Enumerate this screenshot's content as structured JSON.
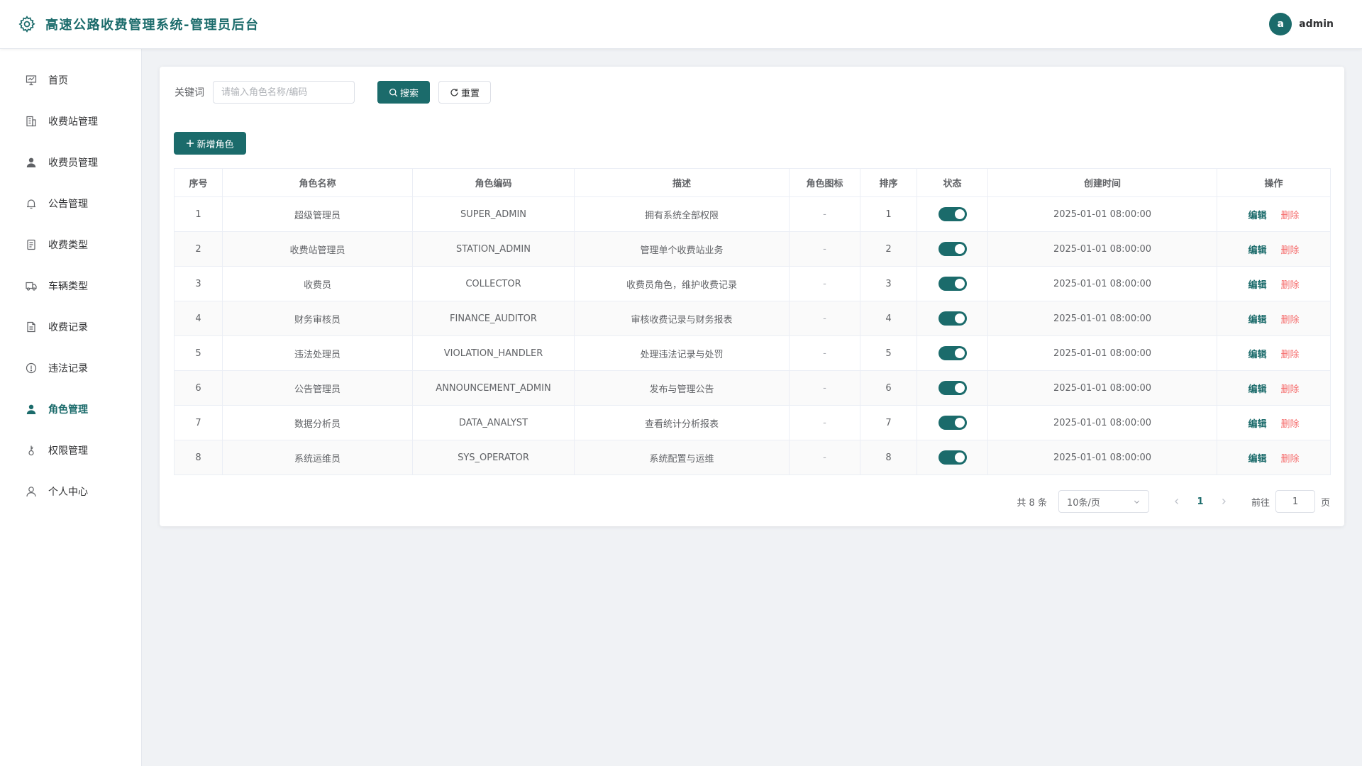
{
  "header": {
    "title": "高速公路收费管理系统-管理员后台",
    "avatar_letter": "a",
    "username": "admin"
  },
  "sidebar": {
    "items": [
      {
        "label": "首页",
        "icon": "presentation-board-icon"
      },
      {
        "label": "收费站管理",
        "icon": "building-icon"
      },
      {
        "label": "收费员管理",
        "icon": "user-filled-icon"
      },
      {
        "label": "公告管理",
        "icon": "bell-icon"
      },
      {
        "label": "收费类型",
        "icon": "list-doc-icon"
      },
      {
        "label": "车辆类型",
        "icon": "truck-icon"
      },
      {
        "label": "收费记录",
        "icon": "document-icon"
      },
      {
        "label": "违法记录",
        "icon": "warning-circle-icon"
      },
      {
        "label": "角色管理",
        "icon": "user-filled-icon",
        "active": true
      },
      {
        "label": "权限管理",
        "icon": "key-icon"
      },
      {
        "label": "个人中心",
        "icon": "user-outline-icon"
      }
    ]
  },
  "search": {
    "label": "关键词",
    "placeholder": "请输入角色名称/编码",
    "search_label": "搜索",
    "reset_label": "重置"
  },
  "toolbar": {
    "add_label": "新增角色"
  },
  "table": {
    "columns": [
      "序号",
      "角色名称",
      "角色编码",
      "描述",
      "角色图标",
      "排序",
      "状态",
      "创建时间",
      "操作"
    ],
    "edit_label": "编辑",
    "delete_label": "删除",
    "rows": [
      {
        "index": "1",
        "name": "超级管理员",
        "code": "SUPER_ADMIN",
        "desc": "拥有系统全部权限",
        "icon": "-",
        "sort": "1",
        "enabled": true,
        "created": "2025-01-01 08:00:00"
      },
      {
        "index": "2",
        "name": "收费站管理员",
        "code": "STATION_ADMIN",
        "desc": "管理单个收费站业务",
        "icon": "-",
        "sort": "2",
        "enabled": true,
        "created": "2025-01-01 08:00:00"
      },
      {
        "index": "3",
        "name": "收费员",
        "code": "COLLECTOR",
        "desc": "收费员角色，维护收费记录",
        "icon": "-",
        "sort": "3",
        "enabled": true,
        "created": "2025-01-01 08:00:00"
      },
      {
        "index": "4",
        "name": "财务审核员",
        "code": "FINANCE_AUDITOR",
        "desc": "审核收费记录与财务报表",
        "icon": "-",
        "sort": "4",
        "enabled": true,
        "created": "2025-01-01 08:00:00"
      },
      {
        "index": "5",
        "name": "违法处理员",
        "code": "VIOLATION_HANDLER",
        "desc": "处理违法记录与处罚",
        "icon": "-",
        "sort": "5",
        "enabled": true,
        "created": "2025-01-01 08:00:00"
      },
      {
        "index": "6",
        "name": "公告管理员",
        "code": "ANNOUNCEMENT_ADMIN",
        "desc": "发布与管理公告",
        "icon": "-",
        "sort": "6",
        "enabled": true,
        "created": "2025-01-01 08:00:00"
      },
      {
        "index": "7",
        "name": "数据分析员",
        "code": "DATA_ANALYST",
        "desc": "查看统计分析报表",
        "icon": "-",
        "sort": "7",
        "enabled": true,
        "created": "2025-01-01 08:00:00"
      },
      {
        "index": "8",
        "name": "系统运维员",
        "code": "SYS_OPERATOR",
        "desc": "系统配置与运维",
        "icon": "-",
        "sort": "8",
        "enabled": true,
        "created": "2025-01-01 08:00:00"
      }
    ]
  },
  "pagination": {
    "total_text": "共 8 条",
    "page_size": "10条/页",
    "current_page": "1",
    "goto_label": "前往",
    "goto_value": "1",
    "page_suffix": "页"
  },
  "colors": {
    "accent": "#1b6b6b",
    "danger": "#f56c6c"
  }
}
